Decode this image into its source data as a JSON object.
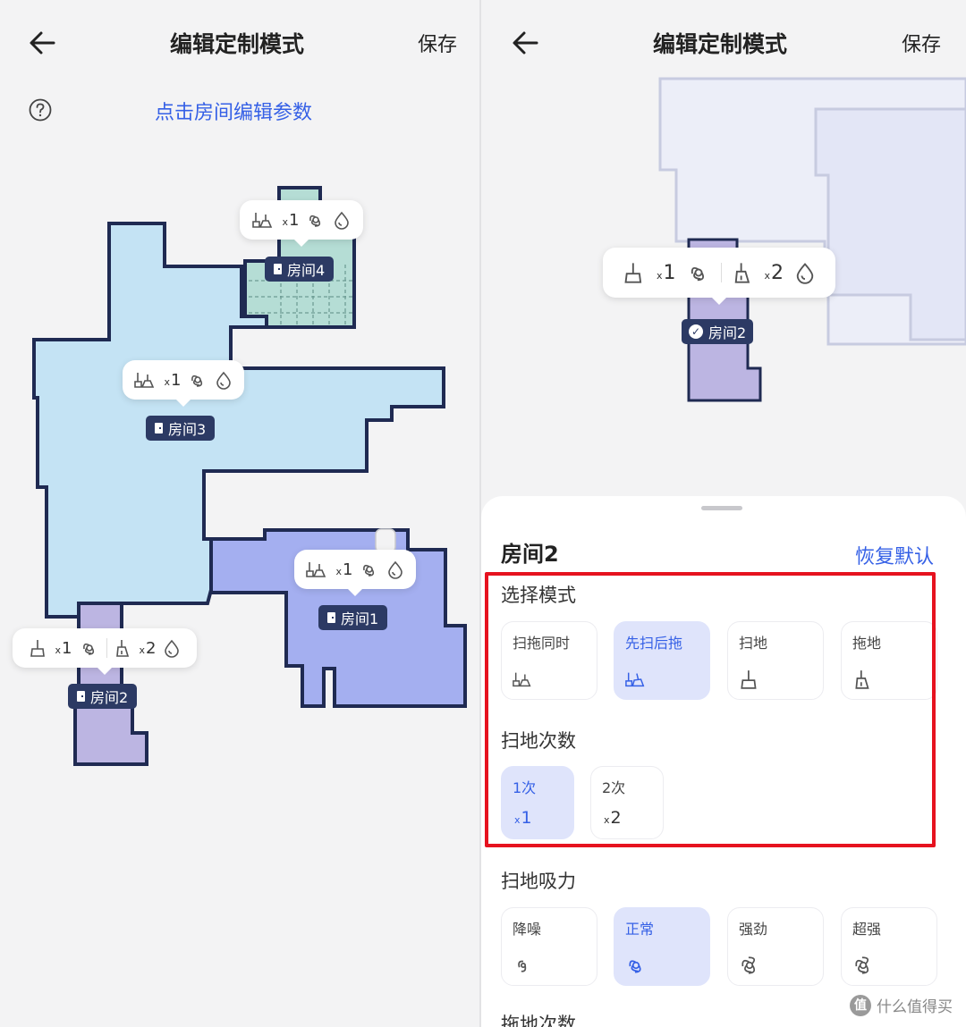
{
  "left_screen": {
    "title": "编辑定制模式",
    "save": "保存",
    "hint": "点击房间编辑参数",
    "rooms": [
      {
        "name": "房间4",
        "fill": "#b5ddd5",
        "settings": {
          "count_prefix": "x",
          "count": "1"
        }
      },
      {
        "name": "房间3",
        "fill": "#c4e3f4",
        "settings": {
          "count_prefix": "x",
          "count": "1"
        }
      },
      {
        "name": "房间1",
        "fill": "#a4aff0",
        "settings": {
          "count_prefix": "x",
          "count": "1"
        }
      },
      {
        "name": "房间2",
        "fill": "#bcb5e2",
        "settings": {
          "count_prefix": "x",
          "count": "1",
          "mop_prefix": "x",
          "mop_count": "2"
        }
      }
    ]
  },
  "right_screen": {
    "title": "编辑定制模式",
    "save": "保存",
    "selected_room_tag": "房间2",
    "room_bubble": {
      "count_prefix": "x",
      "count": "1",
      "mop_prefix": "x",
      "mop_count": "2"
    },
    "sheet": {
      "room_name": "房间2",
      "restore": "恢复默认",
      "mode_section": "选择模式",
      "modes": [
        {
          "label": "扫拖同时",
          "icon": "sweep-mop-icon",
          "selected": false
        },
        {
          "label": "先扫后拖",
          "icon": "sweep-then-mop-icon",
          "selected": true
        },
        {
          "label": "扫地",
          "icon": "sweep-icon",
          "selected": false
        },
        {
          "label": "拖地",
          "icon": "mop-icon",
          "selected": false
        }
      ],
      "sweep_times_section": "扫地次数",
      "sweep_times": [
        {
          "label": "1次",
          "prefix": "x",
          "value": "1",
          "selected": true
        },
        {
          "label": "2次",
          "prefix": "x",
          "value": "2",
          "selected": false
        }
      ],
      "suction_section": "扫地吸力",
      "suction": [
        {
          "label": "降噪",
          "icon": "fan-quiet-icon",
          "selected": false
        },
        {
          "label": "正常",
          "icon": "fan-normal-icon",
          "selected": true
        },
        {
          "label": "强劲",
          "icon": "fan-strong-icon",
          "selected": false
        },
        {
          "label": "超强",
          "icon": "fan-max-icon",
          "selected": false
        }
      ],
      "mop_times_section": "拖地次数"
    }
  },
  "watermark": {
    "logo": "值",
    "text": "什么值得买"
  },
  "colors": {
    "accent": "#3560e6",
    "tag_bg": "#2c3a64",
    "highlight_box": "#e6121f"
  }
}
